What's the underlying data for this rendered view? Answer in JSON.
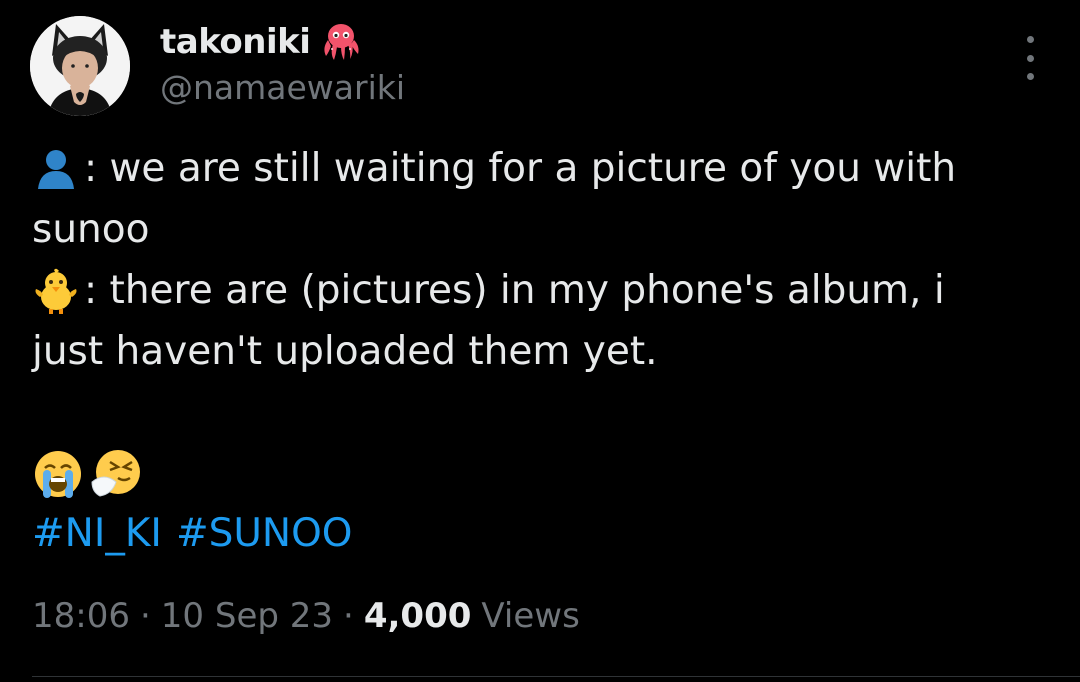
{
  "author": {
    "display_name": "takoniki",
    "handle": "@namaewariki",
    "name_emoji": "octopus-icon"
  },
  "tweet": {
    "lines": [
      {
        "emoji": "bust-in-silhouette-icon",
        "text": ": we are still waiting for a picture of you with"
      },
      {
        "emoji": "",
        "text": "sunoo"
      },
      {
        "emoji": "front-facing-baby-chick-icon",
        "text": ": there are (pictures) in my phone's album, i"
      },
      {
        "emoji": "",
        "text": "just haven't uploaded them yet."
      }
    ],
    "trailing_emojis": [
      "loudly-crying-face-icon",
      "sneezing-face-icon"
    ],
    "hashtags": [
      "#NI_KI",
      "#SUNOO"
    ]
  },
  "meta": {
    "time": "18:06",
    "separator": "·",
    "date": "10 Sep 23",
    "views_count": "4,000",
    "views_label": "Views"
  },
  "colors": {
    "background": "#000000",
    "text": "#e7e9ea",
    "secondary_text": "#71767b",
    "link": "#1d9bf0",
    "divider": "#2f3336"
  }
}
